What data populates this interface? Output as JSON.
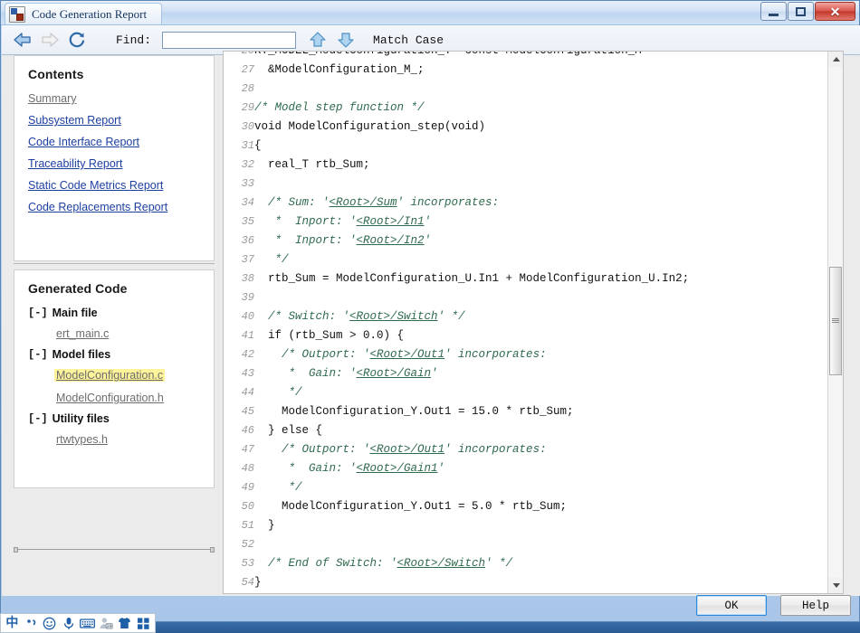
{
  "window": {
    "title": "Code Generation Report",
    "icon": "report-app-icon",
    "minimize_label": "",
    "maximize_label": "",
    "close_label": "✕"
  },
  "toolbar": {
    "back_icon": "back-arrow-icon",
    "forward_icon": "forward-arrow-icon",
    "refresh_icon": "refresh-icon",
    "find_label": "Find:",
    "find_value": "",
    "find_placeholder": "",
    "find_prev_icon": "find-up-arrow-icon",
    "find_next_icon": "find-down-arrow-icon",
    "match_case_label": "Match Case"
  },
  "sidebar": {
    "contents": {
      "title": "Contents",
      "links": [
        {
          "label": "Summary",
          "state": "visited"
        },
        {
          "label": "Subsystem Report",
          "state": "link"
        },
        {
          "label": "Code Interface Report",
          "state": "link"
        },
        {
          "label": "Traceability Report",
          "state": "link"
        },
        {
          "label": "Static Code Metrics Report",
          "state": "link"
        },
        {
          "label": "Code Replacements Report",
          "state": "link"
        }
      ]
    },
    "generated_code": {
      "title": "Generated Code",
      "groups": [
        {
          "toggle": "[-]",
          "label": "Main file",
          "files": [
            {
              "label": "ert_main.c",
              "highlighted": false
            }
          ]
        },
        {
          "toggle": "[-]",
          "label": "Model files",
          "files": [
            {
              "label": "ModelConfiguration.c",
              "highlighted": true
            },
            {
              "label": "ModelConfiguration.h",
              "highlighted": false
            }
          ]
        },
        {
          "toggle": "[-]",
          "label": "Utility files",
          "files": [
            {
              "label": "rtwtypes.h",
              "highlighted": false
            }
          ]
        }
      ]
    }
  },
  "code": {
    "first_visible_line": 26,
    "last_visible_line": 54,
    "lines": [
      {
        "n": 26,
        "parts": [
          {
            "t": "RT_MODEL_ModelConfiguration_T *const ModelConfiguration_M =",
            "c": "plain"
          }
        ]
      },
      {
        "n": 27,
        "parts": [
          {
            "t": "  &ModelConfiguration_M_;",
            "c": "plain"
          }
        ]
      },
      {
        "n": 28,
        "parts": [
          {
            "t": "",
            "c": "plain"
          }
        ]
      },
      {
        "n": 29,
        "parts": [
          {
            "t": "/* Model step function */",
            "c": "cmt"
          }
        ]
      },
      {
        "n": 30,
        "parts": [
          {
            "t": "void ModelConfiguration_step(void)",
            "c": "plain"
          }
        ]
      },
      {
        "n": 31,
        "parts": [
          {
            "t": "{",
            "c": "plain"
          }
        ]
      },
      {
        "n": 32,
        "parts": [
          {
            "t": "  real_T rtb_Sum;",
            "c": "plain"
          }
        ]
      },
      {
        "n": 33,
        "parts": [
          {
            "t": "",
            "c": "plain"
          }
        ]
      },
      {
        "n": 34,
        "parts": [
          {
            "t": "  /* Sum: '",
            "c": "cmt"
          },
          {
            "t": "<Root>/Sum",
            "c": "lnk"
          },
          {
            "t": "' incorporates:",
            "c": "cmt"
          }
        ]
      },
      {
        "n": 35,
        "parts": [
          {
            "t": "   *  Inport: '",
            "c": "cmt"
          },
          {
            "t": "<Root>/In1",
            "c": "lnk"
          },
          {
            "t": "'",
            "c": "cmt"
          }
        ]
      },
      {
        "n": 36,
        "parts": [
          {
            "t": "   *  Inport: '",
            "c": "cmt"
          },
          {
            "t": "<Root>/In2",
            "c": "lnk"
          },
          {
            "t": "'",
            "c": "cmt"
          }
        ]
      },
      {
        "n": 37,
        "parts": [
          {
            "t": "   */",
            "c": "cmt"
          }
        ]
      },
      {
        "n": 38,
        "parts": [
          {
            "t": "  rtb_Sum = ModelConfiguration_U.In1 + ModelConfiguration_U.In2;",
            "c": "plain"
          }
        ]
      },
      {
        "n": 39,
        "parts": [
          {
            "t": "",
            "c": "plain"
          }
        ]
      },
      {
        "n": 40,
        "parts": [
          {
            "t": "  /* Switch: '",
            "c": "cmt"
          },
          {
            "t": "<Root>/Switch",
            "c": "lnk"
          },
          {
            "t": "' */",
            "c": "cmt"
          }
        ]
      },
      {
        "n": 41,
        "parts": [
          {
            "t": "  if (rtb_Sum > 0.0) {",
            "c": "plain"
          }
        ]
      },
      {
        "n": 42,
        "parts": [
          {
            "t": "    /* Outport: '",
            "c": "cmt"
          },
          {
            "t": "<Root>/Out1",
            "c": "lnk"
          },
          {
            "t": "' incorporates:",
            "c": "cmt"
          }
        ]
      },
      {
        "n": 43,
        "parts": [
          {
            "t": "     *  Gain: '",
            "c": "cmt"
          },
          {
            "t": "<Root>/Gain",
            "c": "lnk"
          },
          {
            "t": "'",
            "c": "cmt"
          }
        ]
      },
      {
        "n": 44,
        "parts": [
          {
            "t": "     */",
            "c": "cmt"
          }
        ]
      },
      {
        "n": 45,
        "parts": [
          {
            "t": "    ModelConfiguration_Y.Out1 = 15.0 * rtb_Sum;",
            "c": "plain"
          }
        ]
      },
      {
        "n": 46,
        "parts": [
          {
            "t": "  } else {",
            "c": "plain"
          }
        ]
      },
      {
        "n": 47,
        "parts": [
          {
            "t": "    /* Outport: '",
            "c": "cmt"
          },
          {
            "t": "<Root>/Out1",
            "c": "lnk"
          },
          {
            "t": "' incorporates:",
            "c": "cmt"
          }
        ]
      },
      {
        "n": 48,
        "parts": [
          {
            "t": "     *  Gain: '",
            "c": "cmt"
          },
          {
            "t": "<Root>/Gain1",
            "c": "lnk"
          },
          {
            "t": "'",
            "c": "cmt"
          }
        ]
      },
      {
        "n": 49,
        "parts": [
          {
            "t": "     */",
            "c": "cmt"
          }
        ]
      },
      {
        "n": 50,
        "parts": [
          {
            "t": "    ModelConfiguration_Y.Out1 = 5.0 * rtb_Sum;",
            "c": "plain"
          }
        ]
      },
      {
        "n": 51,
        "parts": [
          {
            "t": "  }",
            "c": "plain"
          }
        ]
      },
      {
        "n": 52,
        "parts": [
          {
            "t": "",
            "c": "plain"
          }
        ]
      },
      {
        "n": 53,
        "parts": [
          {
            "t": "  /* End of Switch: '",
            "c": "cmt"
          },
          {
            "t": "<Root>/Switch",
            "c": "lnk"
          },
          {
            "t": "' */",
            "c": "cmt"
          }
        ]
      },
      {
        "n": 54,
        "parts": [
          {
            "t": "}",
            "c": "plain"
          }
        ]
      }
    ]
  },
  "footer": {
    "ok_label": "OK",
    "help_label": "Help"
  },
  "ime": {
    "icons": [
      "chinese-mode-icon",
      "punctuation-mode-icon",
      "emoji-icon",
      "microphone-icon",
      "soft-keyboard-icon",
      "user-dictionary-icon",
      "skin-icon",
      "toolbox-icon"
    ],
    "chinese_glyph": "中"
  },
  "colors": {
    "link": "#1d3fa0",
    "visited": "#6d6d6d",
    "comment": "#2f6b4e",
    "highlight": "#fcf39a",
    "accent": "#2f86d6"
  }
}
